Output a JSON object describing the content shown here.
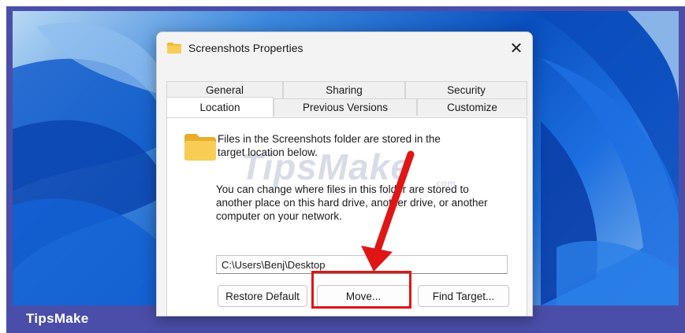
{
  "dialog": {
    "title": "Screenshots Properties",
    "close_label": "✕",
    "tabs_row1": [
      "General",
      "Sharing",
      "Security"
    ],
    "tabs_row2": [
      "Location",
      "Previous Versions",
      "Customize"
    ],
    "active_tab": "Location"
  },
  "location": {
    "info_line1": "Files in the Screenshots folder are stored in the",
    "info_line2": "target location below.",
    "change_line1": "You can change where files in this folder are stored to",
    "change_line2": "another place on this hard drive, another drive, or another",
    "change_line3": "computer on your network.",
    "path_value": "C:\\Users\\Benj\\Desktop",
    "restore_default_label": "Restore Default",
    "move_label": "Move...",
    "find_target_label": "Find Target..."
  },
  "watermark": {
    "text": "TipsMake",
    "suffix": ".com"
  },
  "banner": {
    "text": "TipsMake"
  },
  "colors": {
    "frame": "#4b4ea8",
    "highlight": "#e01616",
    "arrow": "#e01616",
    "folder": "#f5c342"
  },
  "icons": {
    "title_icon": "folder-icon",
    "close_icon": "close-icon",
    "panel_icon": "folder-icon",
    "annotation": "red-arrow-icon"
  }
}
